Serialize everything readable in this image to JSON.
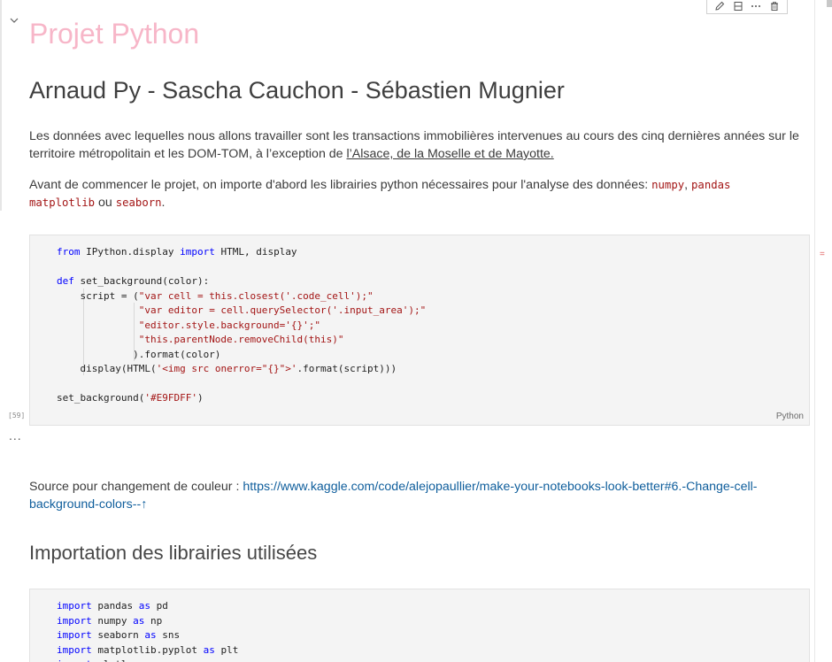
{
  "markdown": {
    "title": "Projet Python",
    "authors": "Arnaud Py - Sascha Cauchon - Sébastien Mugnier",
    "paragraph1": "Les données avec lequelles nous allons travailler sont les transactions immobilières intervenues au cours des cinq dernières années sur le territoire métropolitain et les DOM-TOM, à l’exception de ",
    "paragraph1_link": "l’Alsace, de la Moselle et de Mayotte.",
    "paragraph2_prefix": "Avant de commencer le projet, on importe d'abord les librairies python nécessaires pour l'analyse des données: ",
    "lib_numpy": "numpy",
    "comma": ", ",
    "lib_pandas": "pandas",
    "lib_matplotlib": "matplotlib",
    "ou": " ou ",
    "lib_seaborn": "seaborn",
    "period": ".",
    "source_prefix": "Source pour changement de couleur : ",
    "source_link": "https://www.kaggle.com/code/alejopaullier/make-your-notebooks-look-better#6.-Change-cell-background-colors--↑",
    "section_heading": "Importation des librairies utilisées"
  },
  "cell1": {
    "execution_count": "[59]",
    "language": "Python",
    "output_ellipsis": "...",
    "lines": [
      [
        {
          "t": "from",
          "c": "kw"
        },
        {
          "t": " IPython.display ",
          "c": ""
        },
        {
          "t": "import",
          "c": "kw"
        },
        {
          "t": " HTML, display",
          "c": ""
        }
      ],
      [],
      [
        {
          "t": "def",
          "c": "kw"
        },
        {
          "t": " set_background(color):",
          "c": ""
        }
      ],
      [
        {
          "t": "    script = (",
          "c": ""
        },
        {
          "t": "\"var cell = this.closest('.code_cell');\"",
          "c": "str"
        }
      ],
      [
        {
          "t": "              ",
          "c": ""
        },
        {
          "t": "\"var editor = cell.querySelector('.input_area');\"",
          "c": "str"
        }
      ],
      [
        {
          "t": "              ",
          "c": ""
        },
        {
          "t": "\"editor.style.background='{}';\"",
          "c": "str"
        }
      ],
      [
        {
          "t": "              ",
          "c": ""
        },
        {
          "t": "\"this.parentNode.removeChild(this)\"",
          "c": "str"
        }
      ],
      [
        {
          "t": "             ).format(color)",
          "c": ""
        }
      ],
      [
        {
          "t": "    display(HTML(",
          "c": ""
        },
        {
          "t": "'<img src onerror=\"{}\">'",
          "c": "str"
        },
        {
          "t": ".format(script)))",
          "c": ""
        }
      ],
      [],
      [
        {
          "t": "set_background(",
          "c": ""
        },
        {
          "t": "'#E9FDFF'",
          "c": "str"
        },
        {
          "t": ")",
          "c": ""
        }
      ]
    ]
  },
  "cell2": {
    "lines": [
      [
        {
          "t": "import",
          "c": "kw"
        },
        {
          "t": " pandas ",
          "c": ""
        },
        {
          "t": "as",
          "c": "kw"
        },
        {
          "t": " pd",
          "c": ""
        }
      ],
      [
        {
          "t": "import",
          "c": "kw"
        },
        {
          "t": " numpy ",
          "c": ""
        },
        {
          "t": "as",
          "c": "kw"
        },
        {
          "t": " np",
          "c": ""
        }
      ],
      [
        {
          "t": "import",
          "c": "kw"
        },
        {
          "t": " seaborn ",
          "c": ""
        },
        {
          "t": "as",
          "c": "kw"
        },
        {
          "t": " sns",
          "c": ""
        }
      ],
      [
        {
          "t": "import",
          "c": "kw"
        },
        {
          "t": " matplotlib.pyplot ",
          "c": ""
        },
        {
          "t": "as",
          "c": "kw"
        },
        {
          "t": " plt",
          "c": ""
        }
      ],
      [
        {
          "t": "import",
          "c": "kw"
        },
        {
          "t": " plotly.express ",
          "c": ""
        },
        {
          "t": "as",
          "c": "kw"
        },
        {
          "t": " px",
          "c": ""
        }
      ]
    ]
  },
  "toolbar": {
    "icons": [
      "edit-icon",
      "split-cell-icon",
      "more-icon",
      "delete-icon"
    ]
  },
  "colors": {
    "title": "#f7b6c8",
    "keyword": "#0000ff",
    "string": "#a31515",
    "link": "#0f5e9c",
    "code_background": "#f4f4f4"
  }
}
